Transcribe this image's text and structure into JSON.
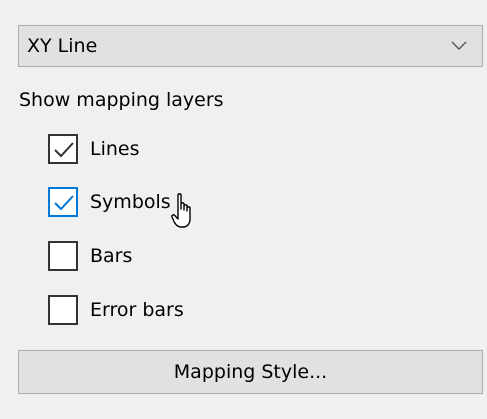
{
  "chart_type_select": {
    "value": "XY Line",
    "icon": "chevron-down-icon"
  },
  "layers": {
    "heading": "Show mapping layers",
    "items": [
      {
        "label": "Lines",
        "checked": true
      },
      {
        "label": "Symbols",
        "checked": true,
        "hovered": true
      },
      {
        "label": "Bars",
        "checked": false
      },
      {
        "label": "Error bars",
        "checked": false
      }
    ]
  },
  "mapping_style_button": {
    "label": "Mapping Style..."
  },
  "colors": {
    "panel_background": "#f0f0f0",
    "control_background": "#e1e1e1",
    "control_border": "#adadad",
    "checkbox_border": "#333333",
    "hover_accent": "#0078d7"
  },
  "cursor": {
    "icon": "hand-pointer-cursor-icon"
  }
}
